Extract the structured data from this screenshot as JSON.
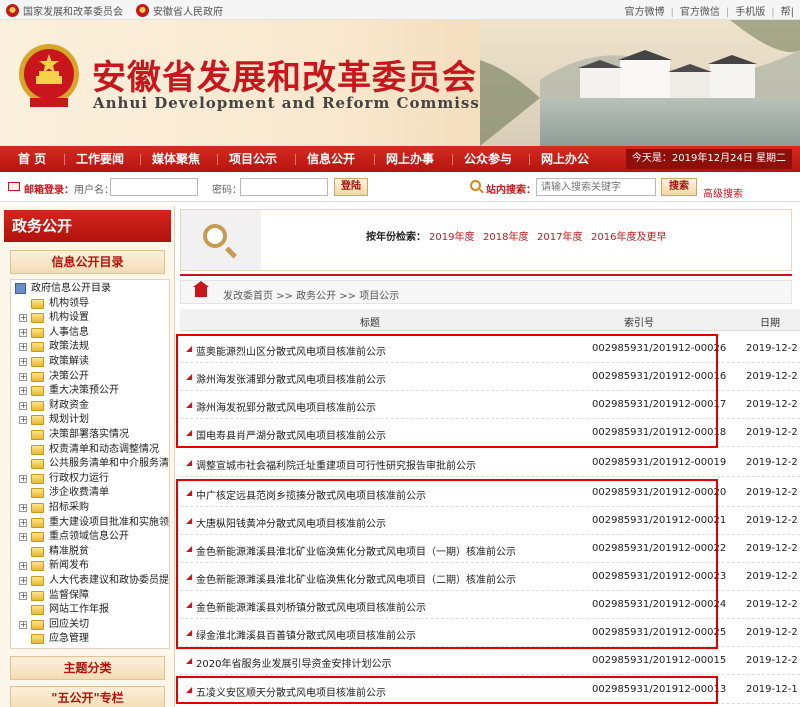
{
  "topbar": {
    "site1": "国家发展和改革委员会",
    "site2": "安徽省人民政府",
    "links": [
      "官方微博",
      "官方微信",
      "手机版",
      "帮|"
    ]
  },
  "banner": {
    "title_cn": "安徽省发展和改革委员会",
    "title_en": "Anhui Development and Reform Commission"
  },
  "nav": {
    "items": [
      "首 页",
      "工作要闻",
      "媒体聚焦",
      "项目公示",
      "信息公开",
      "网上办事",
      "公众参与",
      "网上办公"
    ],
    "date": "今天是：2019年12月24日  星期二"
  },
  "login": {
    "title": "邮箱登录：",
    "user_label": "用户名：",
    "pass_label": "密码：",
    "login_btn": "登陆",
    "search_title": "站内搜索：",
    "search_placeholder": "请输入搜索关键字",
    "search_btn": "搜索",
    "advanced": "高级搜索"
  },
  "sidebar": {
    "header": "政务公开",
    "catalog_title": "信息公开目录",
    "topic_title": "主题分类",
    "five_title": "\"五公开\"专栏",
    "tree": [
      {
        "label": "政府信息公开目录",
        "type": "root"
      },
      {
        "label": "机构领导",
        "type": "leaf"
      },
      {
        "label": "机构设置",
        "type": "branch"
      },
      {
        "label": "人事信息",
        "type": "branch"
      },
      {
        "label": "政策法规",
        "type": "branch"
      },
      {
        "label": "政策解读",
        "type": "branch"
      },
      {
        "label": "决策公开",
        "type": "branch"
      },
      {
        "label": "重大决策预公开",
        "type": "branch"
      },
      {
        "label": "财政资金",
        "type": "branch"
      },
      {
        "label": "规划计划",
        "type": "branch"
      },
      {
        "label": "决策部署落实情况",
        "type": "leaf"
      },
      {
        "label": "权责清单和动态调整情况",
        "type": "leaf"
      },
      {
        "label": "公共服务清单和中介服务清",
        "type": "leaf"
      },
      {
        "label": "行政权力运行",
        "type": "branch"
      },
      {
        "label": "涉企收费清单",
        "type": "leaf"
      },
      {
        "label": "招标采购",
        "type": "branch"
      },
      {
        "label": "重大建设项目批准和实施领",
        "type": "branch"
      },
      {
        "label": "重点领域信息公开",
        "type": "branch"
      },
      {
        "label": "精准脱贫",
        "type": "leaf"
      },
      {
        "label": "新闻发布",
        "type": "branch"
      },
      {
        "label": "人大代表建议和政协委员提",
        "type": "branch"
      },
      {
        "label": "监督保障",
        "type": "branch"
      },
      {
        "label": "网站工作年报",
        "type": "leaf"
      },
      {
        "label": "回应关切",
        "type": "branch"
      },
      {
        "label": "应急管理",
        "type": "leaf"
      }
    ]
  },
  "search": {
    "label": "按年份检索：",
    "years": [
      "2019年度",
      "2018年度",
      "2017年度",
      "2016年度及更早"
    ]
  },
  "breadcrumb": "发改委首页 >> 政务公开 >> 项目公示",
  "table": {
    "headers": [
      "标题",
      "索引号",
      "日期"
    ],
    "rows": [
      {
        "title": "蓝奥能源烈山区分散式风电项目核准前公示",
        "index": "002985931/201912-00026",
        "date": "2019-12-2"
      },
      {
        "title": "滁州海发张浦郢分散式风电项目核准前公示",
        "index": "002985931/201912-00016",
        "date": "2019-12-2"
      },
      {
        "title": "滁州海发祝郢分散式风电项目核准前公示",
        "index": "002985931/201912-00017",
        "date": "2019-12-2"
      },
      {
        "title": "国电寿县肖严湖分散式风电项目核准前公示",
        "index": "002985931/201912-00018",
        "date": "2019-12-2"
      },
      {
        "title": "调整宣城市社会福利院迁址重建项目可行性研究报告审批前公示",
        "index": "002985931/201912-00019",
        "date": "2019-12-2"
      },
      {
        "title": "中广核定远县范岗乡揽揍分散式风电项目核准前公示",
        "index": "002985931/201912-00020",
        "date": "2019-12-2"
      },
      {
        "title": "大唐枞阳钱黄冲分散式风电项目核准前公示",
        "index": "002985931/201912-00021",
        "date": "2019-12-2"
      },
      {
        "title": "金色新能源濉溪县淮北矿业临涣焦化分散式风电项目（一期）核准前公示",
        "index": "002985931/201912-00022",
        "date": "2019-12-2"
      },
      {
        "title": "金色新能源濉溪县淮北矿业临涣焦化分散式风电项目（二期）核准前公示",
        "index": "002985931/201912-00023",
        "date": "2019-12-2"
      },
      {
        "title": "金色新能源濉溪县刘桥镇分散式风电项目核准前公示",
        "index": "002985931/201912-00024",
        "date": "2019-12-2"
      },
      {
        "title": "绿金淮北濉溪县百善镇分散式风电项目核准前公示",
        "index": "002985931/201912-00025",
        "date": "2019-12-2"
      },
      {
        "title": "2020年省服务业发展引导资金安排计划公示",
        "index": "002985931/201912-00015",
        "date": "2019-12-2"
      },
      {
        "title": "五凌义安区顺天分散式风电项目核准前公示",
        "index": "002985931/201912-00013",
        "date": "2019-12-1"
      }
    ]
  },
  "colors": {
    "brand_red": "#c8161d",
    "nav_red": "#c61b15",
    "highlight": "#e00000"
  }
}
